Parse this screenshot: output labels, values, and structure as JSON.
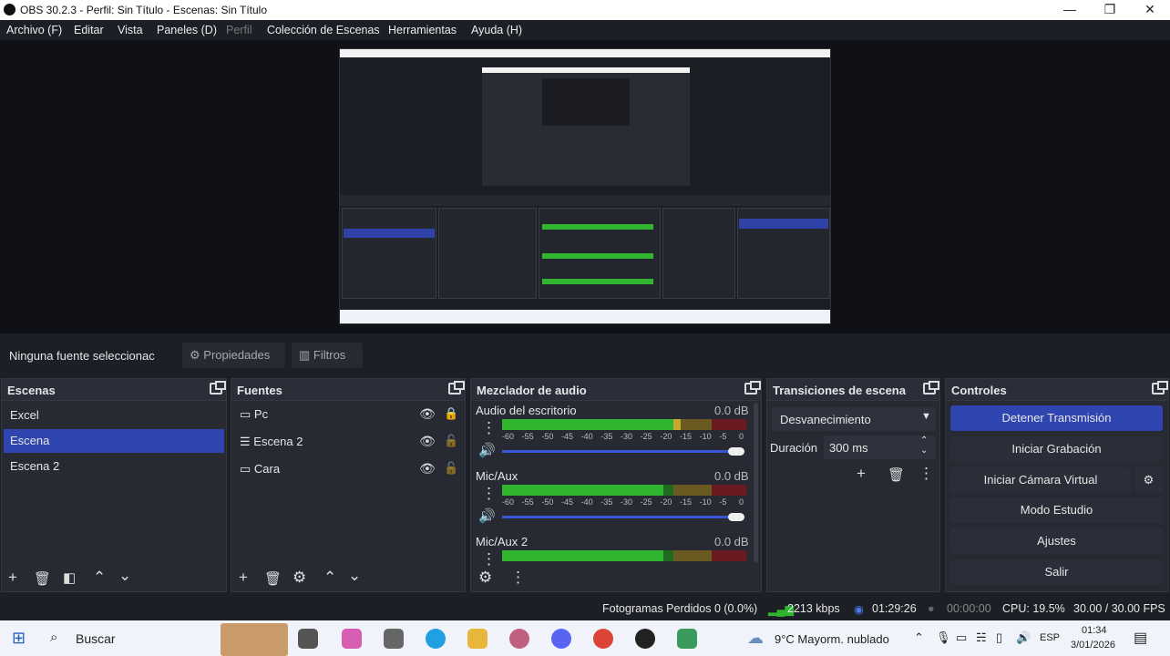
{
  "window": {
    "title": "OBS 30.2.3 - Perfil: Sin Título - Escenas: Sin Título"
  },
  "menu": [
    "Archivo (F)",
    "Editar",
    "Vista",
    "Paneles (D)",
    "Perfil",
    "Colección de Escenas",
    "Herramientas",
    "Ayuda (H)"
  ],
  "source_bar": {
    "no_source": "Ninguna fuente seleccionac",
    "properties": "Propiedades",
    "filters": "Filtros"
  },
  "scenes": {
    "title": "Escenas",
    "items": [
      "Excel",
      "Escena",
      "Escena 2"
    ],
    "selected": "Escena"
  },
  "sources": {
    "title": "Fuentes",
    "items": [
      "Pc",
      "Escena 2",
      "Cara"
    ]
  },
  "mixer": {
    "title": "Mezclador de audio",
    "channels": [
      {
        "name": "Audio del escritorio",
        "db": "0.0 dB",
        "level": 0.73
      },
      {
        "name": "Mic/Aux",
        "db": "0.0 dB",
        "level": 0.66
      },
      {
        "name": "Mic/Aux 2",
        "db": "0.0 dB",
        "level": 0.66
      }
    ],
    "scale": [
      "-60",
      "-55",
      "-50",
      "-45",
      "-40",
      "-35",
      "-30",
      "-25",
      "-20",
      "-15",
      "-10",
      "-5",
      "0"
    ]
  },
  "transitions": {
    "title": "Transiciones de escena",
    "selected": "Desvanecimiento",
    "duration_label": "Duración",
    "duration_value": "300 ms"
  },
  "controls": {
    "title": "Controles",
    "stop_stream": "Detener Transmisión",
    "start_recording": "Iniciar Grabación",
    "start_virtual_cam": "Iniciar Cámara Virtual",
    "studio_mode": "Modo Estudio",
    "settings": "Ajustes",
    "exit": "Salir"
  },
  "status": {
    "dropped": "Fotogramas Perdidos 0 (0.0%)",
    "bitrate": "2213 kbps",
    "stream_time": "01:29:26",
    "rec_time": "00:00:00",
    "cpu": "CPU: 19.5%",
    "fps": "30.00 / 30.00 FPS"
  },
  "taskbar": {
    "search": "Buscar",
    "weather": "9°C  Mayorm. nublado",
    "lang": "ESP",
    "time": "01:34",
    "date": "3/01/2026"
  },
  "colors": {
    "accent": "#2f45b0",
    "meter_green": "#2fb52f",
    "meter_yellow": "#c9a72d",
    "meter_red": "#b2272c"
  }
}
